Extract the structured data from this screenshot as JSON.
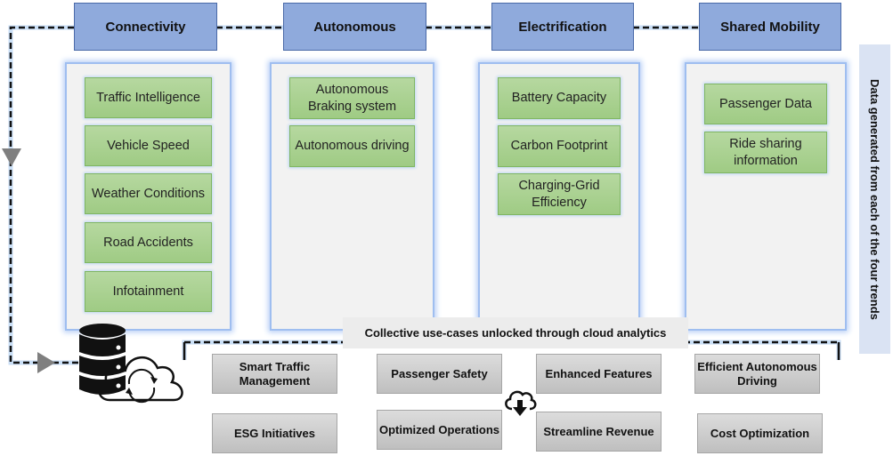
{
  "trends": [
    {
      "title": "Connectivity",
      "items": [
        "Traffic Intelligence",
        "Vehicle Speed",
        "Weather Conditions",
        "Road Accidents",
        "Infotainment"
      ]
    },
    {
      "title": "Autonomous",
      "items": [
        "Autonomous Braking system",
        "Autonomous driving"
      ]
    },
    {
      "title": "Electrification",
      "items": [
        "Battery Capacity",
        "Carbon Footprint",
        "Charging-Grid Efficiency"
      ]
    },
    {
      "title": "Shared Mobility",
      "items": [
        "Passenger Data",
        "Ride sharing information"
      ]
    }
  ],
  "side_label": "Data generated from each of the four trends",
  "banner": "Collective use-cases unlocked through cloud analytics",
  "use_cases": [
    "Smart Traffic Management",
    "Passenger Safety",
    "Enhanced Features",
    "Efficient Autonomous Driving",
    "ESG Initiatives",
    "Optimized Operations",
    "Streamline Revenue",
    "Cost Optimization"
  ],
  "icons": {
    "storage": "database-cloud-sync-icon",
    "download": "cloud-download-icon"
  },
  "colors": {
    "header_fill": "#8faadc",
    "item_fill": "#a9d18e",
    "panel_fill": "#f2f2f2",
    "panel_glow": "#9fbef0",
    "side_label_fill": "#dae3f3",
    "usecase_fill": "#d0d0d0",
    "arrow": "#7f7f7f"
  }
}
